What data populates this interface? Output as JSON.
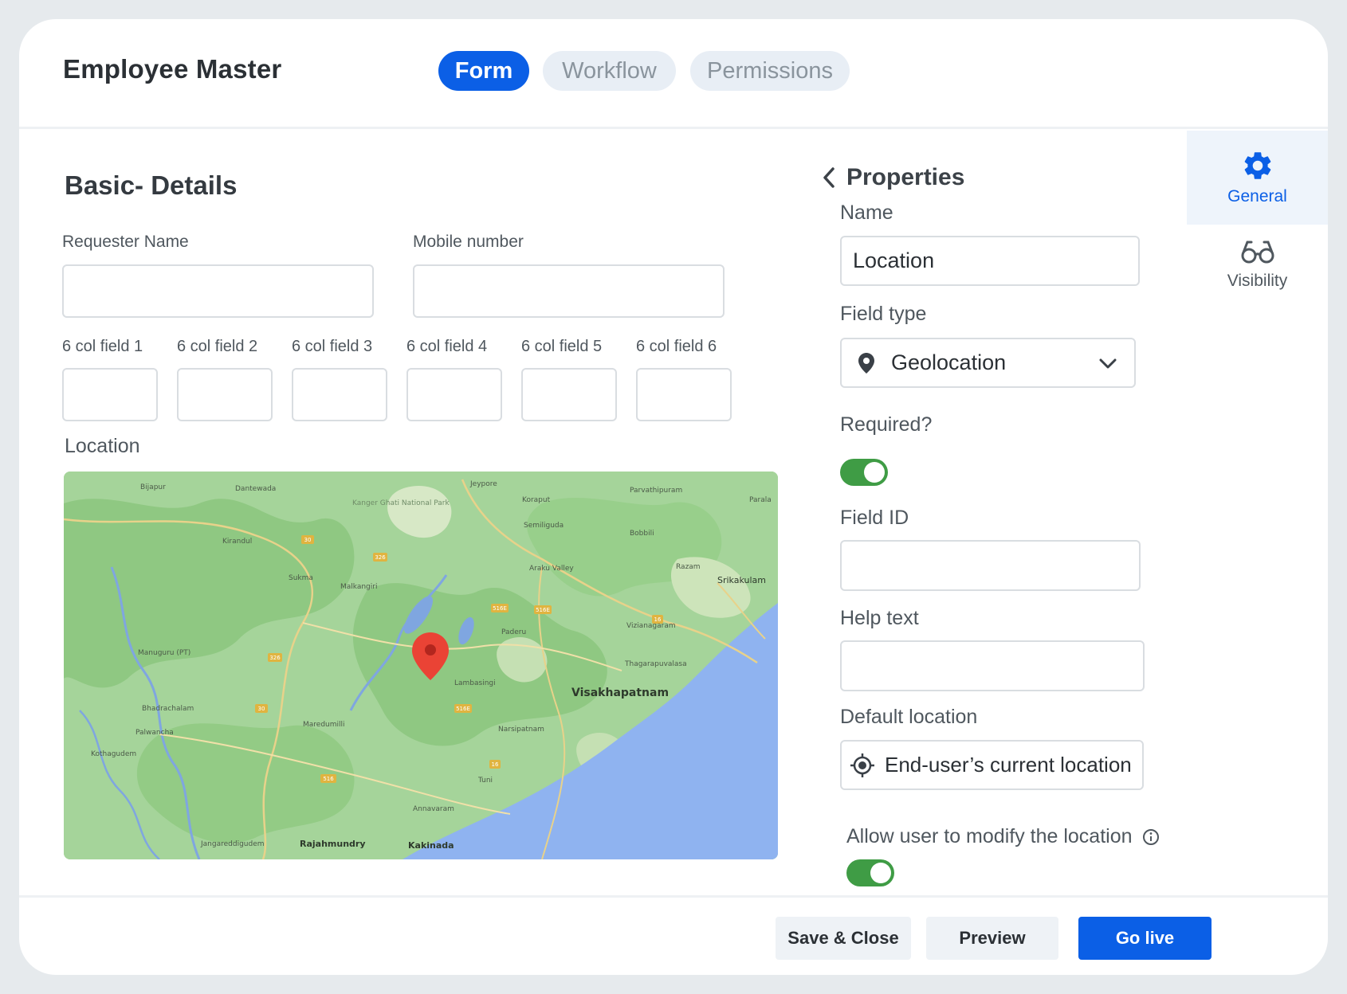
{
  "header": {
    "title": "Employee Master",
    "tabs": [
      {
        "label": "Form",
        "active": true
      },
      {
        "label": "Workflow",
        "active": false
      },
      {
        "label": "Permissions",
        "active": false
      }
    ]
  },
  "form": {
    "section_title": "Basic- Details",
    "requester_label": "Requester Name",
    "mobile_label": "Mobile number",
    "col_fields": [
      "6 col field 1",
      "6 col field 2",
      "6 col field 3",
      "6 col field 4",
      "6 col field 5",
      "6 col field 6"
    ],
    "location_label": "Location"
  },
  "map": {
    "places": {
      "bijapur": "Bijapur",
      "dantewada": "Dantewada",
      "kanger": "Kanger Ghati National Park",
      "jeypore": "Jeypore",
      "koraput": "Koraput",
      "parvathipuram": "Parvathipuram",
      "parala": "Parala",
      "kirandul": "Kirandul",
      "semiliguda": "Semiliguda",
      "bobbili": "Bobbili",
      "sukma": "Sukma",
      "malkangiri": "Malkangiri",
      "araku": "Araku Valley",
      "razam": "Razam",
      "srikakulam": "Srikakulam",
      "paderu": "Paderu",
      "vizianagaram": "Vizianagaram",
      "manuguru": "Manuguru (PT)",
      "thagarapuvalasa": "Thagarapuvalasa",
      "lambasingi": "Lambasingi",
      "visakhapatnam": "Visakhapatnam",
      "bhadrachalam": "Bhadrachalam",
      "maredumilli": "Maredumilli",
      "palwancha": "Palwancha",
      "narsipatnam": "Narsipatnam",
      "kothagudem": "Kothagudem",
      "tuni": "Tuni",
      "annavaram": "Annavaram",
      "jangareddigudem": "Jangareddigudem",
      "rajahmundry": "Rajahmundry",
      "kakinada": "Kakinada"
    },
    "roads": [
      "30",
      "326",
      "516E",
      "16",
      "516"
    ],
    "pin_color": "#ea4335"
  },
  "properties": {
    "title": "Properties",
    "name_label": "Name",
    "name_value": "Location",
    "field_type_label": "Field type",
    "field_type_value": "Geolocation",
    "required_label": "Required?",
    "required_on": true,
    "field_id_label": "Field ID",
    "field_id_value": "",
    "help_text_label": "Help text",
    "help_text_value": "",
    "default_location_label": "Default location",
    "default_location_value": "End-user’s current location",
    "allow_modify_label": "Allow user to modify the location",
    "allow_modify_on": true
  },
  "side_rail": {
    "general": "General",
    "visibility": "Visibility"
  },
  "footer": {
    "save_close": "Save  & Close",
    "preview": "Preview",
    "go_live": "Go live"
  },
  "colors": {
    "accent": "#0b5fe6",
    "toggle_on": "#3f9c45"
  }
}
